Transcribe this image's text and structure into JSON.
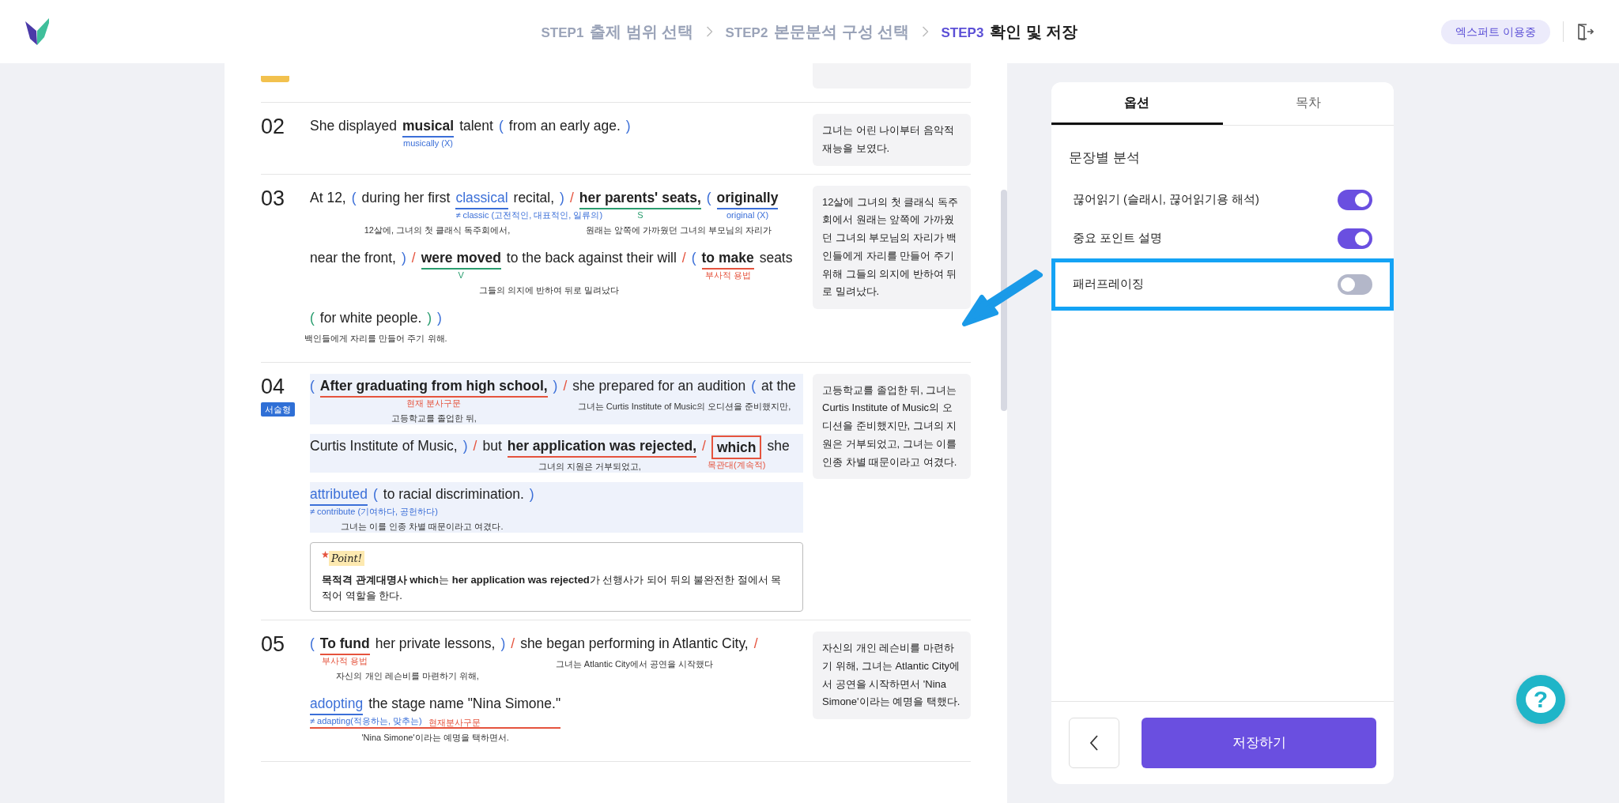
{
  "header": {
    "steps": [
      {
        "code": "STEP1",
        "title": "출제 범위 선택",
        "selected": false
      },
      {
        "code": "STEP2",
        "title": "본문분석 구성 선택",
        "selected": false
      },
      {
        "code": "STEP3",
        "title": "확인 및 저장",
        "selected": true
      }
    ],
    "plan_badge": "엑스퍼트 이용중"
  },
  "sentences": [
    {
      "number": "02",
      "lines": [
        {
          "highlighted": false,
          "chunks": [
            {
              "tokens": [
                {
                  "kind": "text",
                  "text": "She displayed"
                },
                {
                  "kind": "key",
                  "text": "musical",
                  "color": "#3b6fd8",
                  "note": "musically (X)"
                },
                {
                  "kind": "text",
                  "text": "talent"
                },
                {
                  "kind": "paren",
                  "text": "(",
                  "color": "#3b6fd8"
                },
                {
                  "kind": "text",
                  "text": "from an early age."
                },
                {
                  "kind": "paren",
                  "text": ")",
                  "color": "#3b6fd8"
                }
              ]
            }
          ]
        }
      ],
      "translation": "그녀는 어린 나이부터 음악적 재능을 보였다."
    },
    {
      "number": "03",
      "lines": [
        {
          "highlighted": false,
          "chunks": [
            {
              "tokens": [
                {
                  "kind": "text",
                  "text": "At 12,"
                },
                {
                  "kind": "paren",
                  "text": "(",
                  "color": "#3b6fd8"
                },
                {
                  "kind": "text",
                  "text": "during her first"
                },
                {
                  "kind": "vocab",
                  "text": "classical",
                  "color": "#3b6fd8",
                  "note": "≠ classic (고전적인, 대표적인, 일류의)"
                },
                {
                  "kind": "text",
                  "text": "recital,"
                },
                {
                  "kind": "paren",
                  "text": ")",
                  "color": "#3b6fd8"
                }
              ],
              "gloss": "12살에, 그녀의 첫 클래식 독주회에서,"
            },
            {
              "tokens": [
                {
                  "kind": "slash",
                  "text": "/"
                }
              ]
            },
            {
              "tokens": [
                {
                  "kind": "key",
                  "text": "her parents' seats,",
                  "color": "#2a9d6f",
                  "note": "S"
                },
                {
                  "kind": "paren",
                  "text": "(",
                  "color": "#3b6fd8"
                },
                {
                  "kind": "key",
                  "text": "originally",
                  "color": "#3b6fd8",
                  "note": "original (X)"
                }
              ],
              "gloss": "원래는 앞쪽에 가까웠던 그녀의 부모님의 자리가"
            }
          ]
        },
        {
          "highlighted": false,
          "chunks": [
            {
              "tokens": [
                {
                  "kind": "text",
                  "text": "near the front,"
                },
                {
                  "kind": "paren",
                  "text": ")",
                  "color": "#3b6fd8"
                }
              ]
            },
            {
              "tokens": [
                {
                  "kind": "slash",
                  "text": "/"
                }
              ]
            },
            {
              "tokens": [
                {
                  "kind": "key",
                  "text": "were moved",
                  "color": "#2a9d6f",
                  "note": "V"
                },
                {
                  "kind": "text",
                  "text": "to the back against their will"
                }
              ],
              "gloss": "그들의 의지에 반하여 뒤로 밀려났다"
            },
            {
              "tokens": [
                {
                  "kind": "slash",
                  "text": "/"
                }
              ]
            },
            {
              "tokens": [
                {
                  "kind": "paren",
                  "text": "(",
                  "color": "#3b6fd8"
                },
                {
                  "kind": "key",
                  "text": "to make",
                  "color": "#e5533d",
                  "note": "부사적 용법"
                },
                {
                  "kind": "text",
                  "text": "seats"
                }
              ]
            }
          ]
        },
        {
          "highlighted": false,
          "chunks": [
            {
              "tokens": [
                {
                  "kind": "paren",
                  "text": "(",
                  "color": "#2a9d6f"
                },
                {
                  "kind": "text",
                  "text": "for white people."
                },
                {
                  "kind": "paren",
                  "text": ")",
                  "color": "#2a9d6f"
                },
                {
                  "kind": "paren",
                  "text": ")",
                  "color": "#3b6fd8"
                }
              ],
              "gloss": "백인들에게 자리를 만들어 주기 위해."
            }
          ]
        }
      ],
      "translation": "12살에 그녀의 첫 클래식 독주회에서 원래는 앞쪽에 가까웠던 그녀의 부모님의 자리가 백인들에게 자리를 만들어 주기 위해 그들의 의지에 반하여 뒤로 밀려났다."
    },
    {
      "number": "04",
      "badge": "서술형",
      "lines": [
        {
          "highlighted": true,
          "chunks": [
            {
              "tokens": [
                {
                  "kind": "paren",
                  "text": "(",
                  "color": "#3b6fd8"
                },
                {
                  "kind": "key",
                  "text": "After graduating from high school,",
                  "color": "#e5533d",
                  "note": "현재 분사구문"
                },
                {
                  "kind": "paren",
                  "text": ")",
                  "color": "#3b6fd8"
                }
              ],
              "gloss": "고등학교를 졸업한 뒤,"
            },
            {
              "tokens": [
                {
                  "kind": "slash",
                  "text": "/"
                }
              ]
            },
            {
              "tokens": [
                {
                  "kind": "text",
                  "text": "she prepared for an audition"
                },
                {
                  "kind": "paren",
                  "text": "(",
                  "color": "#3b6fd8"
                },
                {
                  "kind": "text",
                  "text": "at the"
                }
              ],
              "gloss": "그녀는 Curtis Institute of Music의 오디션을 준비했지만,"
            }
          ]
        },
        {
          "highlighted": true,
          "chunks": [
            {
              "tokens": [
                {
                  "kind": "text",
                  "text": "Curtis Institute of Music,"
                },
                {
                  "kind": "paren",
                  "text": ")",
                  "color": "#3b6fd8"
                }
              ]
            },
            {
              "tokens": [
                {
                  "kind": "slash",
                  "text": "/"
                }
              ]
            },
            {
              "tokens": [
                {
                  "kind": "text",
                  "text": "but"
                },
                {
                  "kind": "key",
                  "text": "her application was rejected,",
                  "color": "#e5533d"
                }
              ],
              "gloss": "그녀의 지원은 거부되었고,"
            },
            {
              "tokens": [
                {
                  "kind": "slash",
                  "text": "/"
                }
              ]
            },
            {
              "tokens": [
                {
                  "kind": "boxed",
                  "text": "which",
                  "color": "#e5533d",
                  "note": "목관대(계속적)"
                },
                {
                  "kind": "text",
                  "text": "she"
                }
              ]
            }
          ]
        },
        {
          "highlighted": true,
          "chunks": [
            {
              "tokens": [
                {
                  "kind": "vocab",
                  "text": "attributed",
                  "color": "#3b6fd8",
                  "note": "≠ contribute (기여하다, 공헌하다)"
                },
                {
                  "kind": "paren",
                  "text": "(",
                  "color": "#3b6fd8"
                },
                {
                  "kind": "text",
                  "text": "to racial discrimination."
                },
                {
                  "kind": "paren",
                  "text": ")",
                  "color": "#3b6fd8"
                }
              ],
              "gloss": "그녀는 이를 인종 차별 때문이라고 여겼다."
            }
          ]
        }
      ],
      "point": {
        "label": "Point!",
        "text": "**목적격 관계대명사 which**는 **her application was rejected**가 선행사가 되어 뒤의 불완전한 절에서 목적어 역할을 한다."
      },
      "translation": "고등학교를 졸업한 뒤, 그녀는 Curtis Institute of Music의 오디션을 준비했지만, 그녀의 지원은 거부되었고, 그녀는 이를 인종 차별 때문이라고 여겼다."
    },
    {
      "number": "05",
      "lines": [
        {
          "highlighted": false,
          "chunks": [
            {
              "tokens": [
                {
                  "kind": "paren",
                  "text": "(",
                  "color": "#3b6fd8"
                },
                {
                  "kind": "key",
                  "text": "To fund",
                  "color": "#e5533d",
                  "note": "부사적 용법"
                },
                {
                  "kind": "text",
                  "text": "her private lessons,"
                },
                {
                  "kind": "paren",
                  "text": ")",
                  "color": "#3b6fd8"
                }
              ],
              "gloss": "자신의 개인 레슨비를 마련하기 위해,"
            },
            {
              "tokens": [
                {
                  "kind": "slash",
                  "text": "/"
                }
              ]
            },
            {
              "tokens": [
                {
                  "kind": "text",
                  "text": "she began performing in Atlantic City,"
                }
              ],
              "gloss": "그녀는 Atlantic City에서 공연을 시작했다"
            },
            {
              "tokens": [
                {
                  "kind": "slash",
                  "text": "/"
                }
              ]
            }
          ]
        },
        {
          "highlighted": false,
          "chunks": [
            {
              "tokens": [
                {
                  "kind": "vocab",
                  "text": "adopting",
                  "color": "#3b6fd8",
                  "note": "≠ adapting(적응하는, 맞추는)"
                },
                {
                  "kind": "text",
                  "text": "the stage name \"Nina Simone.\""
                }
              ],
              "color": "#e5533d",
              "note": "현재분사구문",
              "gloss": "'Nina Simone'이라는 예명을 택하면서."
            }
          ]
        }
      ],
      "translation": "자신의 개인 레슨비를 마련하기 위해, 그녀는 Atlantic City에서 공연을 시작하면서 'Nina Simone'이라는 예명을 택했다."
    }
  ],
  "panel": {
    "tabs": [
      {
        "label": "옵션",
        "selected": true
      },
      {
        "label": "목차",
        "selected": false
      }
    ],
    "section_title": "문장별 분석",
    "options": [
      {
        "label": "끊어읽기 (슬래시, 끊어읽기용 해석)",
        "on": true,
        "highlighted": false
      },
      {
        "label": "중요 포인트 설명",
        "on": true,
        "highlighted": false
      },
      {
        "label": "패러프레이징",
        "on": false,
        "highlighted": true
      }
    ],
    "save_button": "저장하기"
  },
  "help_button": "?"
}
